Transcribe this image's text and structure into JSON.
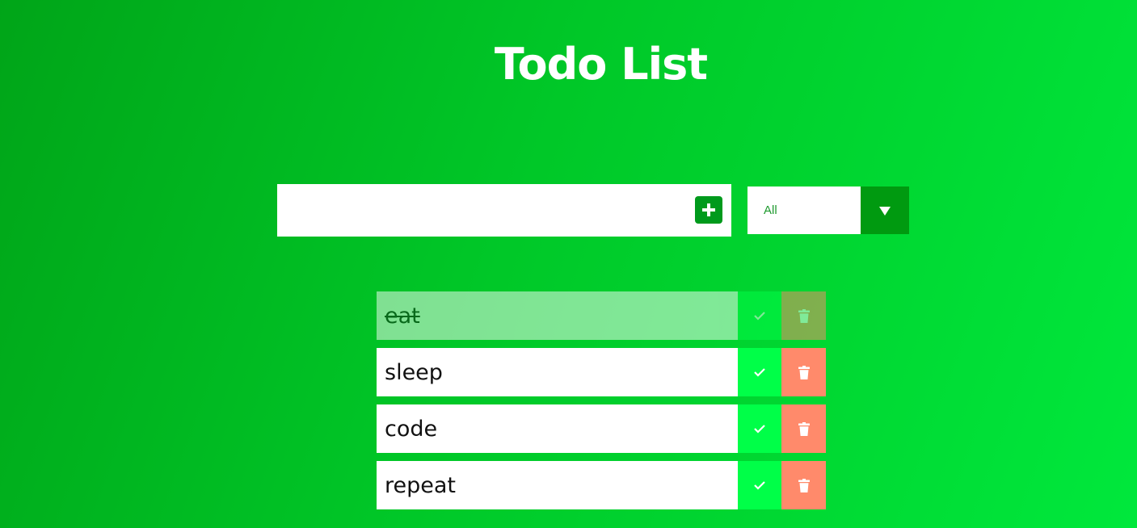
{
  "app": {
    "title": "Todo List"
  },
  "input": {
    "value": "",
    "placeholder": ""
  },
  "add_button": {
    "icon": "plus-icon"
  },
  "filter": {
    "selected": "All"
  },
  "todos": [
    {
      "text": "eat",
      "completed": true
    },
    {
      "text": "sleep",
      "completed": false
    },
    {
      "text": "code",
      "completed": false
    },
    {
      "text": "repeat",
      "completed": false
    }
  ],
  "colors": {
    "background_start": "#00a518",
    "background_end": "#00e83c",
    "accent_dark_green": "#009a10",
    "complete_button": "#00ff48",
    "trash_button": "#ff8a6b",
    "filter_text": "#1f9a2f"
  },
  "icons": {
    "complete": "check-icon",
    "delete": "trash-icon",
    "filter_toggle": "caret-down-icon"
  }
}
